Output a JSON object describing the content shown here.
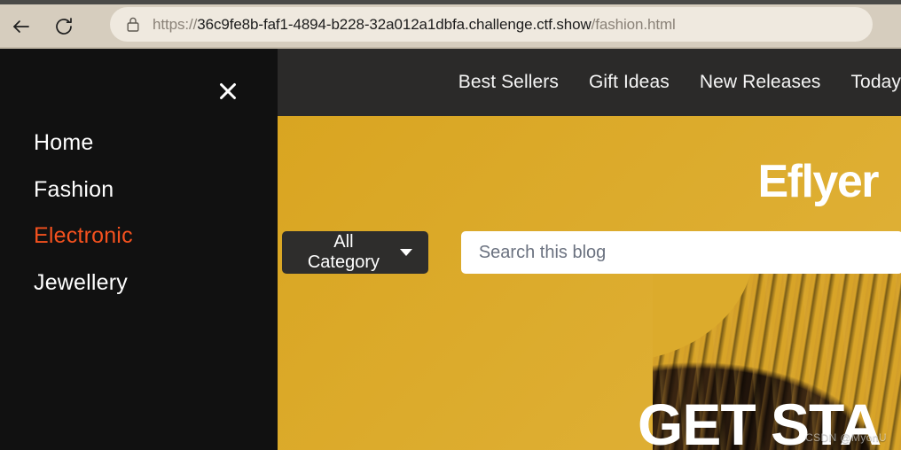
{
  "browser": {
    "back_label": "Back",
    "back_icon": "arrow-left-icon",
    "reload_label": "Reload",
    "reload_icon": "reload-icon",
    "lock_icon": "lock-icon",
    "url_scheme": "https://",
    "url_host": "36c9fe8b-faf1-4894-b228-32a012a1dbfa.challenge.ctf.show",
    "url_path": "/fashion.html",
    "url_full": "https://36c9fe8b-faf1-4894-b228-32a012a1dbfa.challenge.ctf.show/fashion.html"
  },
  "sidebar": {
    "close_label": "✕",
    "close_icon": "close-icon",
    "items": [
      {
        "label": "Home",
        "active": false
      },
      {
        "label": "Fashion",
        "active": false
      },
      {
        "label": "Electronic",
        "active": true
      },
      {
        "label": "Jewellery",
        "active": false
      }
    ],
    "active_color": "#F4511E",
    "background": "#111111"
  },
  "topnav": {
    "background": "#2b2a29",
    "items": [
      {
        "label": "Best Sellers"
      },
      {
        "label": "Gift Ideas"
      },
      {
        "label": "New Releases"
      },
      {
        "label": "Today"
      }
    ]
  },
  "hero": {
    "brand": "Eflyer",
    "background_color": "#dcab2c",
    "category_button": {
      "label": "All Category",
      "caret_icon": "chevron-down-icon"
    },
    "search": {
      "placeholder": "Search this blog",
      "value": ""
    },
    "headline": "GET STA",
    "photo_alt": "woman-hair-photo"
  },
  "watermark": {
    "text": "CSDN @MyonU"
  }
}
